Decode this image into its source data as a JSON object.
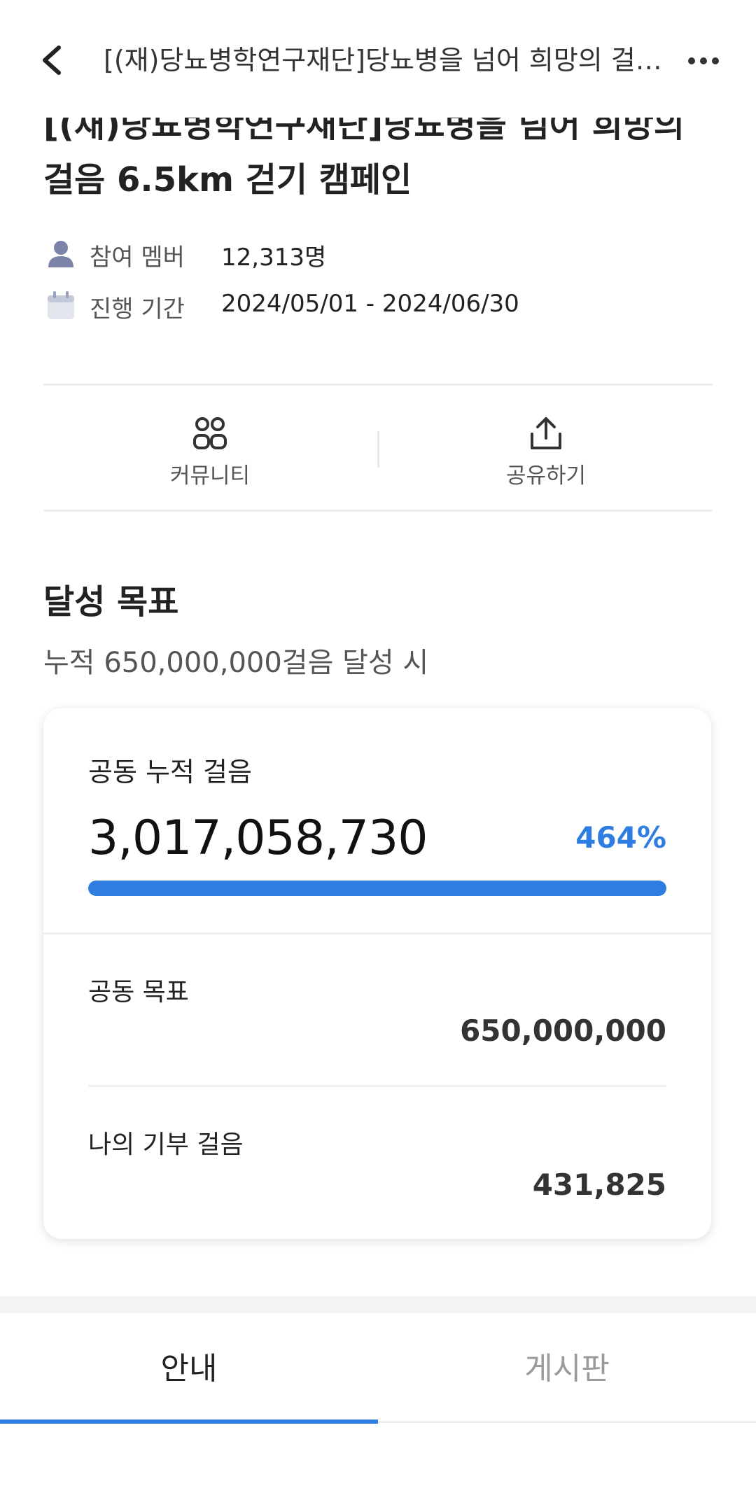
{
  "header": {
    "title": "[(재)당뇨병학연구재단]당뇨병을 넘어 희망의 걸음 6.5km 걷기 캠페인",
    "back_icon": "chevron-left-icon",
    "more_icon": "more-horizontal-icon"
  },
  "campaign": {
    "title": "[(재)당뇨병학연구재단]당뇨병을 넘어 희망의 걸음 6.5km 걷기 캠페인",
    "members_label": "참여 멤버",
    "members_value": "12,313명",
    "period_label": "진행 기간",
    "period_value": "2024/05/01 - 2024/06/30"
  },
  "actions": {
    "community_label": "커뮤니티",
    "share_label": "공유하기",
    "community_icon": "people-icon",
    "share_icon": "share-icon"
  },
  "goal": {
    "section_title": "달성 목표",
    "subtitle": "누적 650,000,000걸음 달성 시",
    "total_label": "공동 누적 걸음",
    "total_value": "3,017,058,730",
    "percent": "464%",
    "progress_fraction": 1.0,
    "target_label": "공동 목표",
    "target_value": "650,000,000",
    "my_label": "나의 기부 걸음",
    "my_value": "431,825"
  },
  "tabs": [
    {
      "label": "안내",
      "active": true
    },
    {
      "label": "게시판",
      "active": false
    }
  ],
  "colors": {
    "accent": "#2f7de1",
    "text": "#222222",
    "muted": "#9a9a9a"
  }
}
